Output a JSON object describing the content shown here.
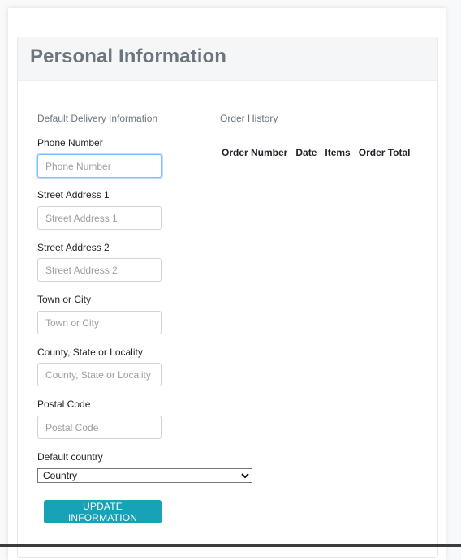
{
  "panel": {
    "title": "Personal Information"
  },
  "delivery": {
    "heading": "Default Delivery Information",
    "fields": [
      {
        "label": "Phone Number",
        "placeholder": "Phone Number",
        "value": ""
      },
      {
        "label": "Street Address 1",
        "placeholder": "Street Address 1",
        "value": ""
      },
      {
        "label": "Street Address 2",
        "placeholder": "Street Address 2",
        "value": ""
      },
      {
        "label": "Town or City",
        "placeholder": "Town or City",
        "value": ""
      },
      {
        "label": "County, State or Locality",
        "placeholder": "County, State or Locality",
        "value": ""
      },
      {
        "label": "Postal Code",
        "placeholder": "Postal Code",
        "value": ""
      }
    ],
    "country_label": "Default country",
    "country_selected": "Country",
    "update_button_label": "UPDATE INFORMATION"
  },
  "orders": {
    "heading": "Order History",
    "columns": [
      "Order Number",
      "Date",
      "Items",
      "Order Total"
    ],
    "rows": []
  },
  "colors": {
    "accent": "#17a2b8",
    "title_gray": "#6c757d",
    "focus_border": "#80bdff"
  }
}
